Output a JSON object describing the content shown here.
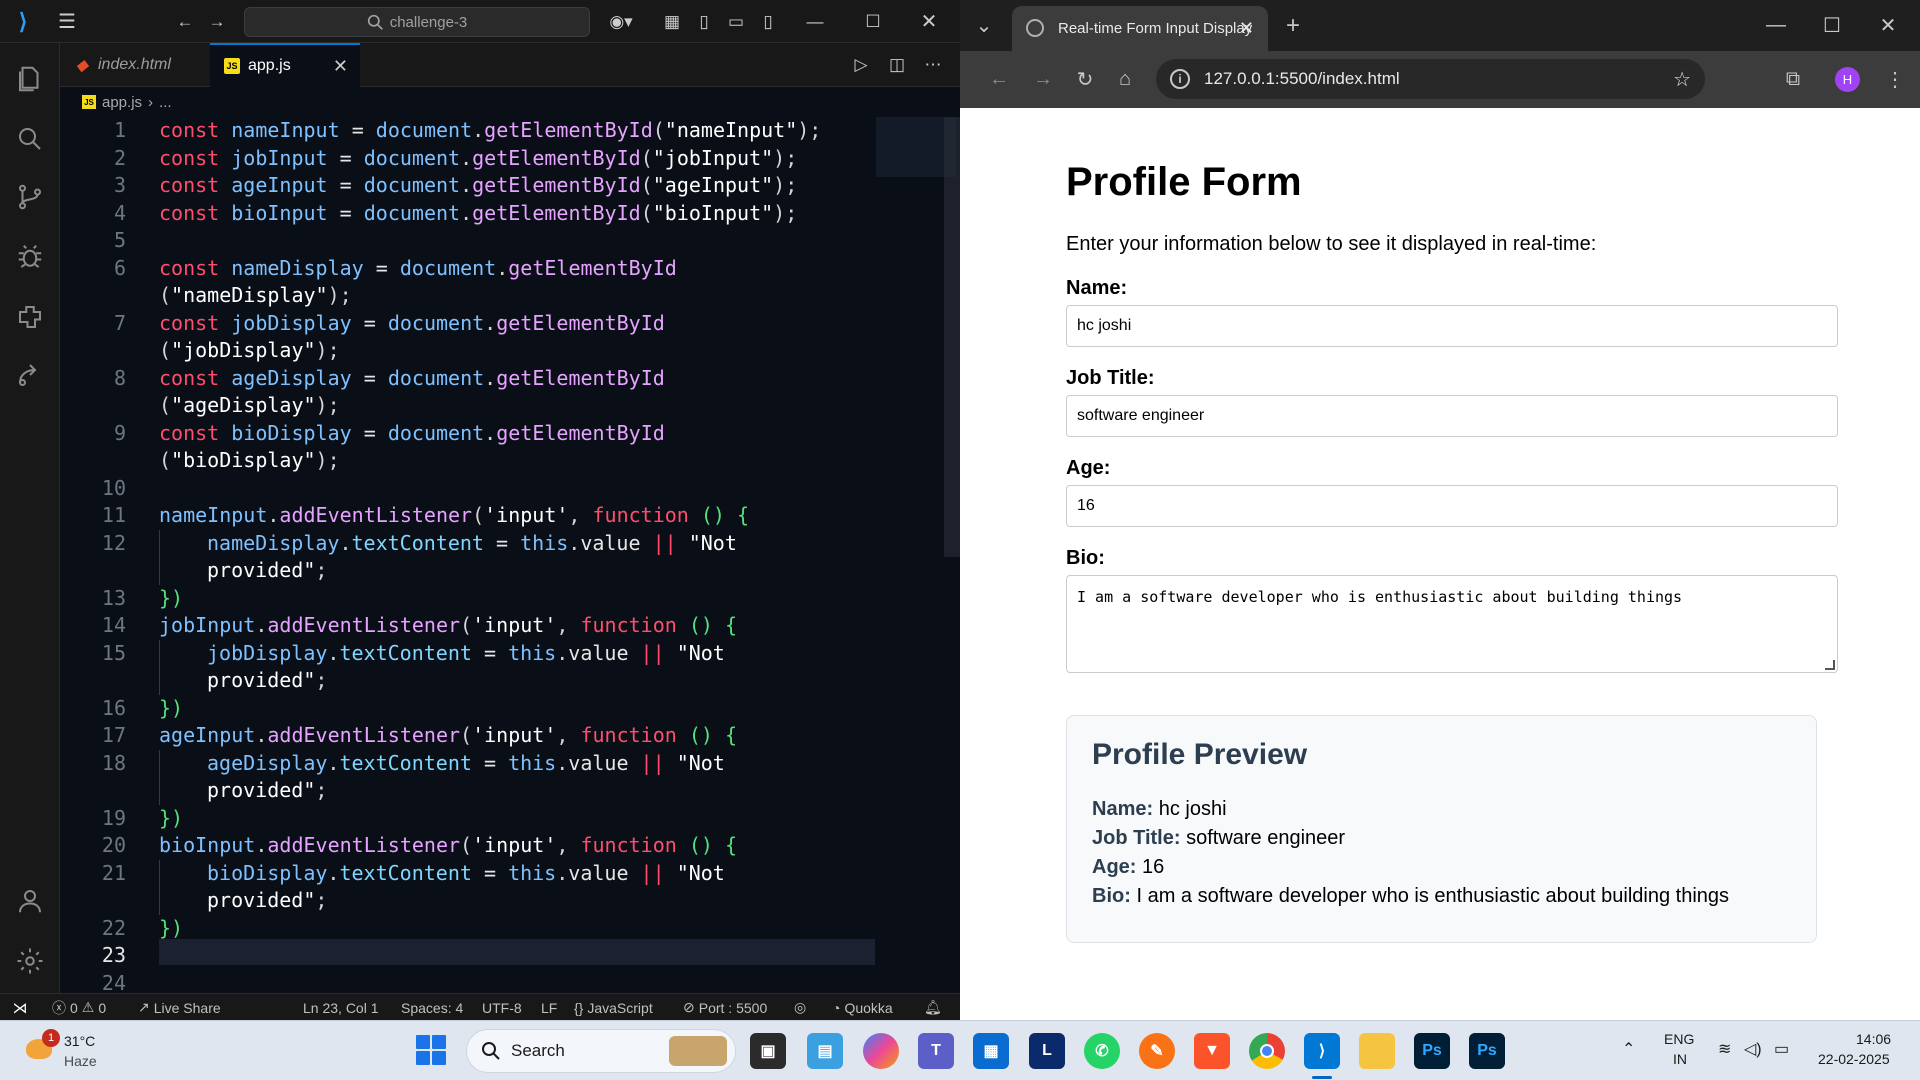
{
  "vscode": {
    "search_text": "challenge-3",
    "tabs": [
      {
        "label": "index.html",
        "icon": "html5-icon"
      },
      {
        "label": "app.js",
        "icon": "js-icon"
      }
    ],
    "breadcrumb": {
      "file": "app.js",
      "more": "..."
    },
    "status": {
      "errors": "0",
      "warnings": "0",
      "live_share": "Live Share",
      "position": "Ln 23, Col 1",
      "spaces": "Spaces: 4",
      "encoding": "UTF-8",
      "eol": "LF",
      "language": "JavaScript",
      "port": "Port : 5500",
      "quokka": "Quokka"
    },
    "line_numbers": [
      "1",
      "2",
      "3",
      "4",
      "5",
      "6",
      "",
      "7",
      "",
      "8",
      "",
      "9",
      "",
      "10",
      "11",
      "12",
      "",
      "13",
      "14",
      "15",
      "",
      "16",
      "17",
      "18",
      "",
      "19",
      "20",
      "21",
      "",
      "22",
      "23",
      "24"
    ]
  },
  "browser": {
    "tab_title": "Real-time Form Input Display",
    "url": "127.0.0.1:5500/index.html",
    "avatar_letter": "H",
    "page": {
      "title": "Profile Form",
      "intro": "Enter your information below to see it displayed in real-time:",
      "name_label": "Name:",
      "name_value": "hc joshi",
      "job_label": "Job Title:",
      "job_value": "software engineer",
      "age_label": "Age:",
      "age_value": "16",
      "bio_label": "Bio:",
      "bio_value": "I am a software developer who is enthusiastic about building things",
      "preview_title": "Profile Preview",
      "preview": [
        {
          "label": "Name:",
          "value": "hc joshi"
        },
        {
          "label": "Job Title:",
          "value": "software engineer"
        },
        {
          "label": "Age:",
          "value": "16"
        },
        {
          "label": "Bio:",
          "value": "I am a software developer who is enthusiastic about building things"
        }
      ]
    }
  },
  "taskbar": {
    "weather_temp": "31°C",
    "weather_cond": "Haze",
    "weather_badge": "1",
    "search_label": "Search",
    "lang_top": "ENG",
    "lang_bottom": "IN",
    "time": "14:06",
    "date": "22-02-2025",
    "apps": [
      "file-explorer-icon",
      "photos-icon",
      "copilot-icon",
      "teams-icon",
      "store-icon",
      "l-app-icon",
      "whatsapp-icon",
      "pen-app-icon",
      "brave-icon",
      "chrome-icon",
      "vscode-icon",
      "folder-icon",
      "photoshop-icon",
      "photoshop-icon"
    ],
    "l_app_letter": "L",
    "ps_label": "Ps"
  },
  "colors": {
    "accent": "#0078d4",
    "keyword": "#ff4d6d",
    "variable": "#7fc1ff",
    "function": "#e6a3ff"
  }
}
